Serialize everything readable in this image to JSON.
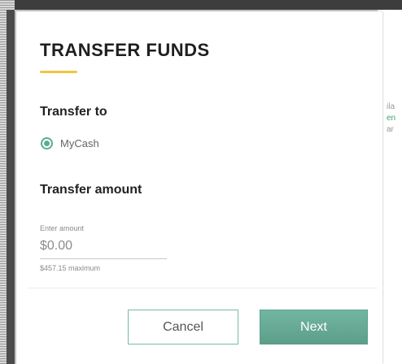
{
  "background": {
    "peek_lines": [
      {
        "text": "ila",
        "tone": "gray"
      },
      {
        "text": "en",
        "tone": "green"
      },
      {
        "text": "ar",
        "tone": "gray"
      }
    ]
  },
  "modal": {
    "title": "TRANSFER FUNDS",
    "transfer_to": {
      "label": "Transfer to",
      "options": [
        {
          "label": "MyCash",
          "selected": true
        }
      ]
    },
    "transfer_amount": {
      "label": "Transfer amount",
      "field_label": "Enter amount",
      "value": "",
      "placeholder": "$0.00",
      "helper": "$457.15 maximum"
    },
    "buttons": {
      "cancel": "Cancel",
      "next": "Next"
    }
  },
  "colors": {
    "accent_yellow": "#f2c440",
    "primary_green": "#5aad8e",
    "button_green": "#6aae99"
  }
}
